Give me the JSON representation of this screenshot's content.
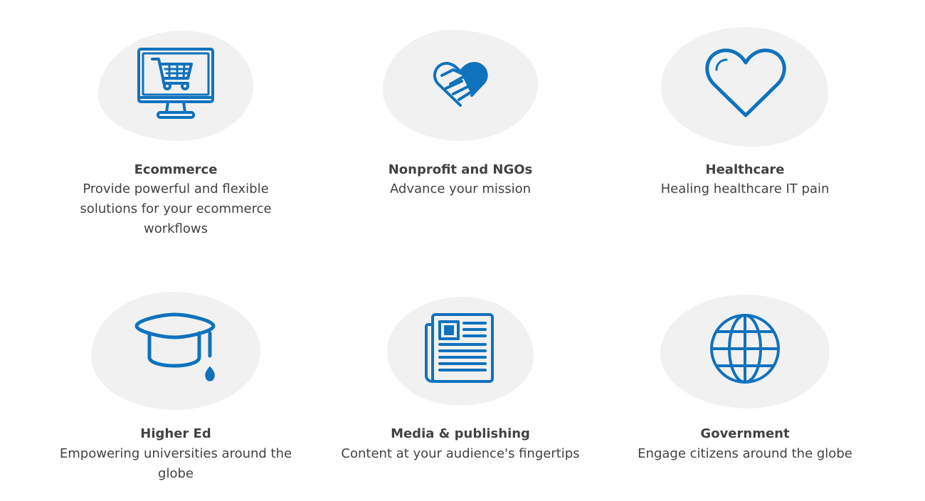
{
  "industries": [
    {
      "title": "Ecommerce",
      "desc": "Provide powerful and flexible solutions for your ecommerce workflows",
      "icon": "shopping-cart-monitor-icon"
    },
    {
      "title": "Nonprofit and NGOs",
      "desc": "Advance your mission",
      "icon": "handshake-heart-icon"
    },
    {
      "title": "Healthcare",
      "desc": "Healing healthcare IT pain",
      "icon": "heart-icon"
    },
    {
      "title": "Higher Ed",
      "desc": "Empowering universities around the globe",
      "icon": "graduation-cap-icon"
    },
    {
      "title": "Media & publishing",
      "desc": "Content at your audience's fingertips",
      "icon": "newspaper-icon"
    },
    {
      "title": "Government",
      "desc": "Engage citizens around the globe",
      "icon": "globe-icon"
    }
  ],
  "colors": {
    "accent": "#0f72bd",
    "blob": "#f1f1f1",
    "text": "#424242"
  }
}
